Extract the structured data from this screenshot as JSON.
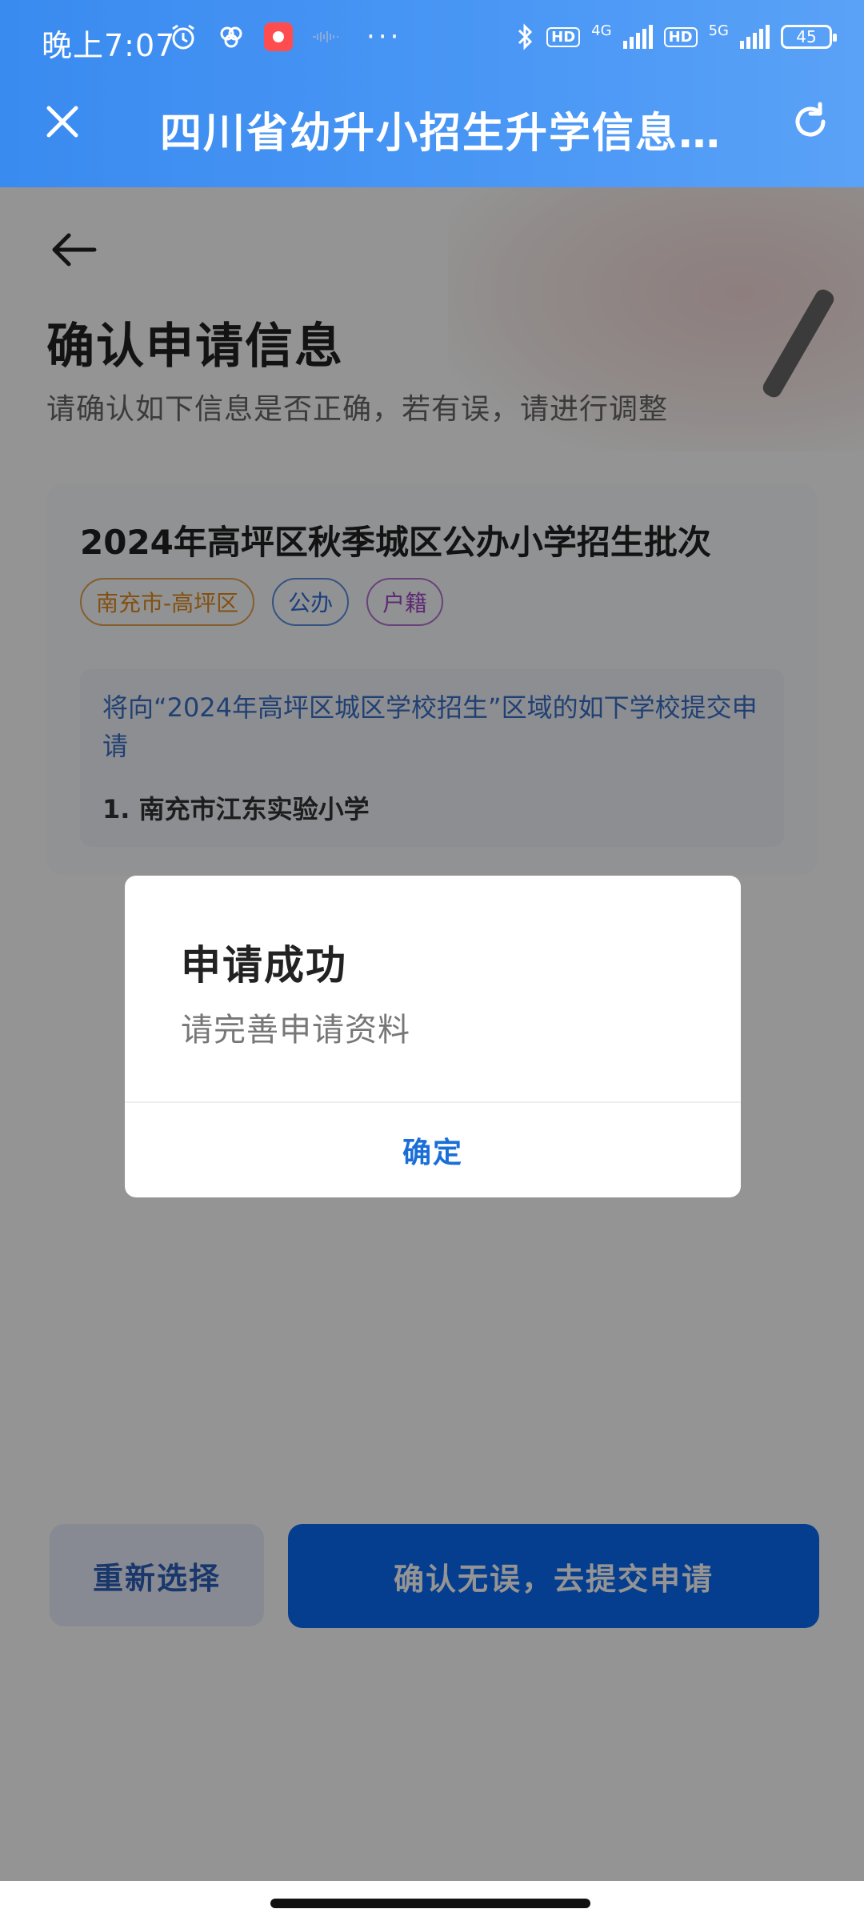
{
  "status_bar": {
    "time": "晚上7:07",
    "network_4g": "4G",
    "network_5g": "5G",
    "hd": "HD",
    "battery": "45"
  },
  "nav": {
    "title": "四川省幼升小招生升学信息…"
  },
  "page": {
    "title": "确认申请信息",
    "subtitle": "请确认如下信息是否正确，若有误，请进行调整"
  },
  "card": {
    "title": "2024年高坪区秋季城区公办小学招生批次",
    "tags": [
      "南充市-高坪区",
      "公办",
      "户籍"
    ],
    "info_text": "将向“2024年高坪区城区学校招生”区域的如下学校提交申请",
    "schools": [
      "1.  南充市江东实验小学"
    ]
  },
  "buttons": {
    "reselect": "重新选择",
    "submit": "确认无误，去提交申请"
  },
  "dialog": {
    "title": "申请成功",
    "message": "请完善申请资料",
    "confirm": "确定"
  },
  "colors": {
    "header_blue": "#3a8bf0",
    "primary": "#0a6cf5",
    "tag_region": "#e08a1c",
    "tag_public": "#2f6fd6",
    "tag_hukou": "#a348c8"
  }
}
